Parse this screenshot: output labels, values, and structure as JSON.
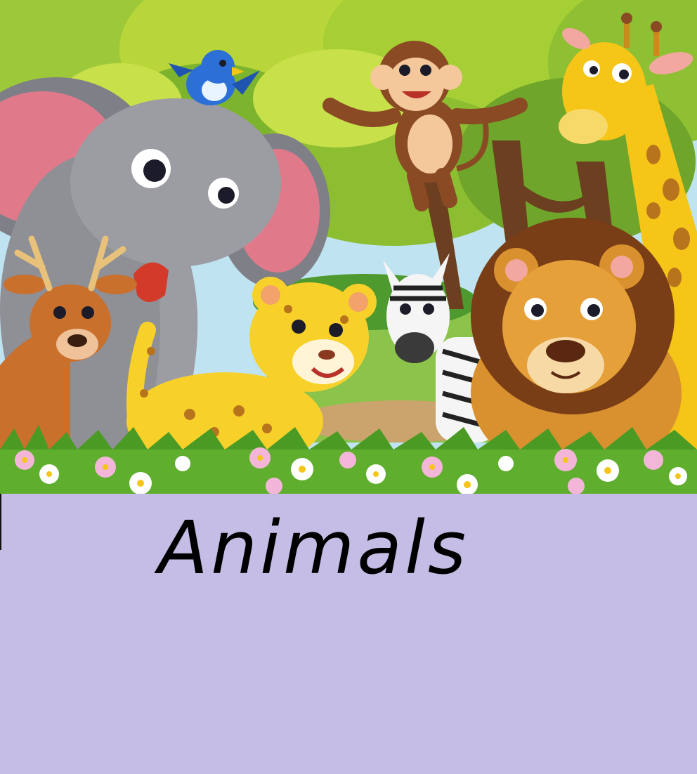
{
  "title": "Animals",
  "colors": {
    "panel": "#c5bde5",
    "foliage_light": "#b8d63a",
    "foliage_dark": "#6fa52a",
    "trunk": "#6b3f1f",
    "grass": "#5fae2e",
    "sky": "#bfe3f0",
    "elephant": "#8f8f96",
    "elephant_ear": "#e07a8a",
    "monkey": "#8a4a24",
    "giraffe": "#f5c518",
    "lion_mane": "#7a3e16",
    "lion_face": "#d9912f",
    "leopard": "#f7d12a",
    "deer": "#c8702c",
    "bird": "#2c6fd6",
    "flowers": "#f4b6d8"
  },
  "illustration": {
    "animals": [
      "elephant",
      "bird",
      "monkey",
      "giraffe",
      "deer",
      "leopard",
      "zebra",
      "lion"
    ]
  }
}
